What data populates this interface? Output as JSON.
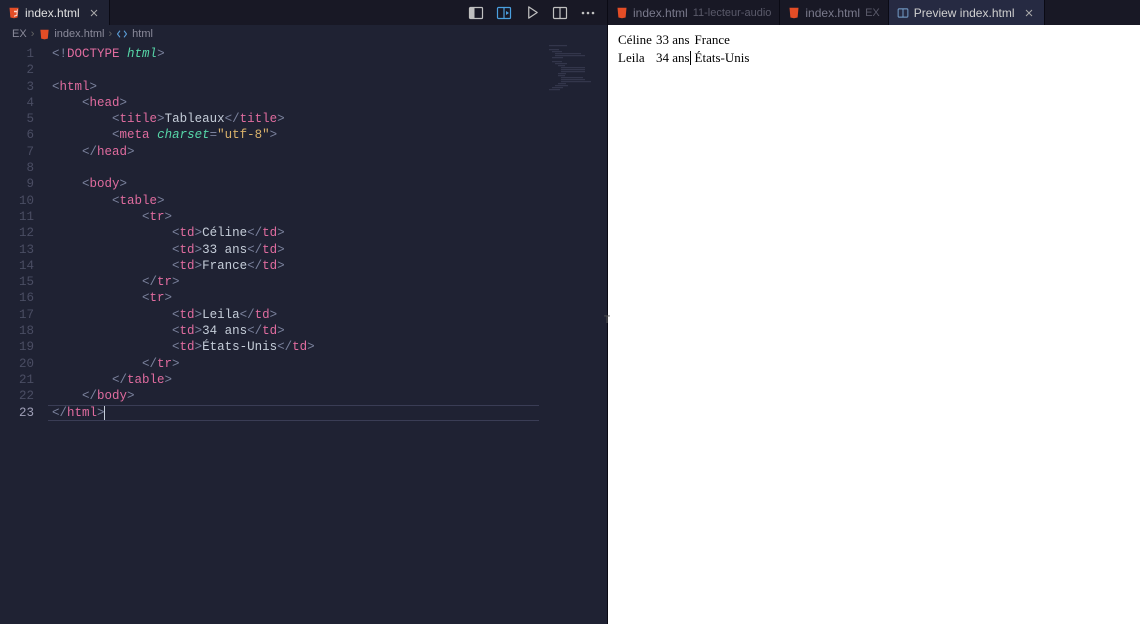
{
  "left": {
    "tab": {
      "label": "index.html"
    },
    "toolbar_icons": {
      "panelLayout": "panel-layout-icon",
      "openPreview": "open-preview-icon",
      "run": "run-icon",
      "splitEditor": "split-editor-icon",
      "more": "more-icon"
    },
    "breadcrumb": {
      "root": "EX",
      "file": "index.html",
      "symbol": "html"
    },
    "code": {
      "lines": [
        {
          "n": 1,
          "segs": [
            {
              "c": "c-punc",
              "t": "<!"
            },
            {
              "c": "c-dockey",
              "t": "DOCTYPE"
            },
            {
              "c": "c-punc",
              "t": " "
            },
            {
              "c": "c-attr",
              "t": "html"
            },
            {
              "c": "c-punc",
              "t": ">"
            }
          ],
          "indent": 0
        },
        {
          "n": 2,
          "segs": [],
          "indent": 0
        },
        {
          "n": 3,
          "segs": [
            {
              "c": "c-punc",
              "t": "<"
            },
            {
              "c": "c-tag",
              "t": "html"
            },
            {
              "c": "c-punc",
              "t": ">"
            }
          ],
          "indent": 0
        },
        {
          "n": 4,
          "segs": [
            {
              "c": "c-punc",
              "t": "<"
            },
            {
              "c": "c-tag",
              "t": "head"
            },
            {
              "c": "c-punc",
              "t": ">"
            }
          ],
          "indent": 4
        },
        {
          "n": 5,
          "segs": [
            {
              "c": "c-punc",
              "t": "<"
            },
            {
              "c": "c-tag",
              "t": "title"
            },
            {
              "c": "c-punc",
              "t": ">"
            },
            {
              "c": "c-text",
              "t": "Tableaux"
            },
            {
              "c": "c-punc",
              "t": "</"
            },
            {
              "c": "c-tag",
              "t": "title"
            },
            {
              "c": "c-punc",
              "t": ">"
            }
          ],
          "indent": 8
        },
        {
          "n": 6,
          "segs": [
            {
              "c": "c-punc",
              "t": "<"
            },
            {
              "c": "c-tag",
              "t": "meta"
            },
            {
              "c": "c-punc",
              "t": " "
            },
            {
              "c": "c-attr",
              "t": "charset"
            },
            {
              "c": "c-punc",
              "t": "="
            },
            {
              "c": "c-str",
              "t": "\"utf-8\""
            },
            {
              "c": "c-punc",
              "t": ">"
            }
          ],
          "indent": 8
        },
        {
          "n": 7,
          "segs": [
            {
              "c": "c-punc",
              "t": "</"
            },
            {
              "c": "c-tag",
              "t": "head"
            },
            {
              "c": "c-punc",
              "t": ">"
            }
          ],
          "indent": 4
        },
        {
          "n": 8,
          "segs": [],
          "indent": 0
        },
        {
          "n": 9,
          "segs": [
            {
              "c": "c-punc",
              "t": "<"
            },
            {
              "c": "c-tag",
              "t": "body"
            },
            {
              "c": "c-punc",
              "t": ">"
            }
          ],
          "indent": 4
        },
        {
          "n": 10,
          "segs": [
            {
              "c": "c-punc",
              "t": "<"
            },
            {
              "c": "c-tag",
              "t": "table"
            },
            {
              "c": "c-punc",
              "t": ">"
            }
          ],
          "indent": 8
        },
        {
          "n": 11,
          "segs": [
            {
              "c": "c-punc",
              "t": "<"
            },
            {
              "c": "c-tag",
              "t": "tr"
            },
            {
              "c": "c-punc",
              "t": ">"
            }
          ],
          "indent": 12
        },
        {
          "n": 12,
          "segs": [
            {
              "c": "c-punc",
              "t": "<"
            },
            {
              "c": "c-tag",
              "t": "td"
            },
            {
              "c": "c-punc",
              "t": ">"
            },
            {
              "c": "c-text",
              "t": "Céline"
            },
            {
              "c": "c-punc",
              "t": "</"
            },
            {
              "c": "c-tag",
              "t": "td"
            },
            {
              "c": "c-punc",
              "t": ">"
            }
          ],
          "indent": 16
        },
        {
          "n": 13,
          "segs": [
            {
              "c": "c-punc",
              "t": "<"
            },
            {
              "c": "c-tag",
              "t": "td"
            },
            {
              "c": "c-punc",
              "t": ">"
            },
            {
              "c": "c-text",
              "t": "33 ans"
            },
            {
              "c": "c-punc",
              "t": "</"
            },
            {
              "c": "c-tag",
              "t": "td"
            },
            {
              "c": "c-punc",
              "t": ">"
            }
          ],
          "indent": 16
        },
        {
          "n": 14,
          "segs": [
            {
              "c": "c-punc",
              "t": "<"
            },
            {
              "c": "c-tag",
              "t": "td"
            },
            {
              "c": "c-punc",
              "t": ">"
            },
            {
              "c": "c-text",
              "t": "France"
            },
            {
              "c": "c-punc",
              "t": "</"
            },
            {
              "c": "c-tag",
              "t": "td"
            },
            {
              "c": "c-punc",
              "t": ">"
            }
          ],
          "indent": 16
        },
        {
          "n": 15,
          "segs": [
            {
              "c": "c-punc",
              "t": "</"
            },
            {
              "c": "c-tag",
              "t": "tr"
            },
            {
              "c": "c-punc",
              "t": ">"
            }
          ],
          "indent": 12
        },
        {
          "n": 16,
          "segs": [
            {
              "c": "c-punc",
              "t": "<"
            },
            {
              "c": "c-tag",
              "t": "tr"
            },
            {
              "c": "c-punc",
              "t": ">"
            }
          ],
          "indent": 12
        },
        {
          "n": 17,
          "segs": [
            {
              "c": "c-punc",
              "t": "<"
            },
            {
              "c": "c-tag",
              "t": "td"
            },
            {
              "c": "c-punc",
              "t": ">"
            },
            {
              "c": "c-text",
              "t": "Leila"
            },
            {
              "c": "c-punc",
              "t": "</"
            },
            {
              "c": "c-tag",
              "t": "td"
            },
            {
              "c": "c-punc",
              "t": ">"
            }
          ],
          "indent": 16
        },
        {
          "n": 18,
          "segs": [
            {
              "c": "c-punc",
              "t": "<"
            },
            {
              "c": "c-tag",
              "t": "td"
            },
            {
              "c": "c-punc",
              "t": ">"
            },
            {
              "c": "c-text",
              "t": "34 ans"
            },
            {
              "c": "c-punc",
              "t": "</"
            },
            {
              "c": "c-tag",
              "t": "td"
            },
            {
              "c": "c-punc",
              "t": ">"
            }
          ],
          "indent": 16
        },
        {
          "n": 19,
          "segs": [
            {
              "c": "c-punc",
              "t": "<"
            },
            {
              "c": "c-tag",
              "t": "td"
            },
            {
              "c": "c-punc",
              "t": ">"
            },
            {
              "c": "c-text",
              "t": "États-Unis"
            },
            {
              "c": "c-punc",
              "t": "</"
            },
            {
              "c": "c-tag",
              "t": "td"
            },
            {
              "c": "c-punc",
              "t": ">"
            }
          ],
          "indent": 16
        },
        {
          "n": 20,
          "segs": [
            {
              "c": "c-punc",
              "t": "</"
            },
            {
              "c": "c-tag",
              "t": "tr"
            },
            {
              "c": "c-punc",
              "t": ">"
            }
          ],
          "indent": 12
        },
        {
          "n": 21,
          "segs": [
            {
              "c": "c-punc",
              "t": "</"
            },
            {
              "c": "c-tag",
              "t": "table"
            },
            {
              "c": "c-punc",
              "t": ">"
            }
          ],
          "indent": 8
        },
        {
          "n": 22,
          "segs": [
            {
              "c": "c-punc",
              "t": "</"
            },
            {
              "c": "c-tag",
              "t": "body"
            },
            {
              "c": "c-punc",
              "t": ">"
            }
          ],
          "indent": 4
        },
        {
          "n": 23,
          "segs": [
            {
              "c": "c-punc",
              "t": "</"
            },
            {
              "c": "c-tag",
              "t": "html"
            },
            {
              "c": "c-punc",
              "t": ">"
            }
          ],
          "indent": 0,
          "current": true
        }
      ]
    }
  },
  "right": {
    "tabs": [
      {
        "label": "index.html",
        "sub": "11-lecteur-audio",
        "active": false
      },
      {
        "label": "index.html",
        "sub": "EX",
        "active": false
      },
      {
        "label": "Preview index.html",
        "sub": "",
        "active": true,
        "isPreview": true
      }
    ],
    "previewTable": [
      [
        "Céline",
        "33 ans",
        "France"
      ],
      [
        "Leila",
        "34 ans",
        "États-Unis"
      ]
    ]
  }
}
